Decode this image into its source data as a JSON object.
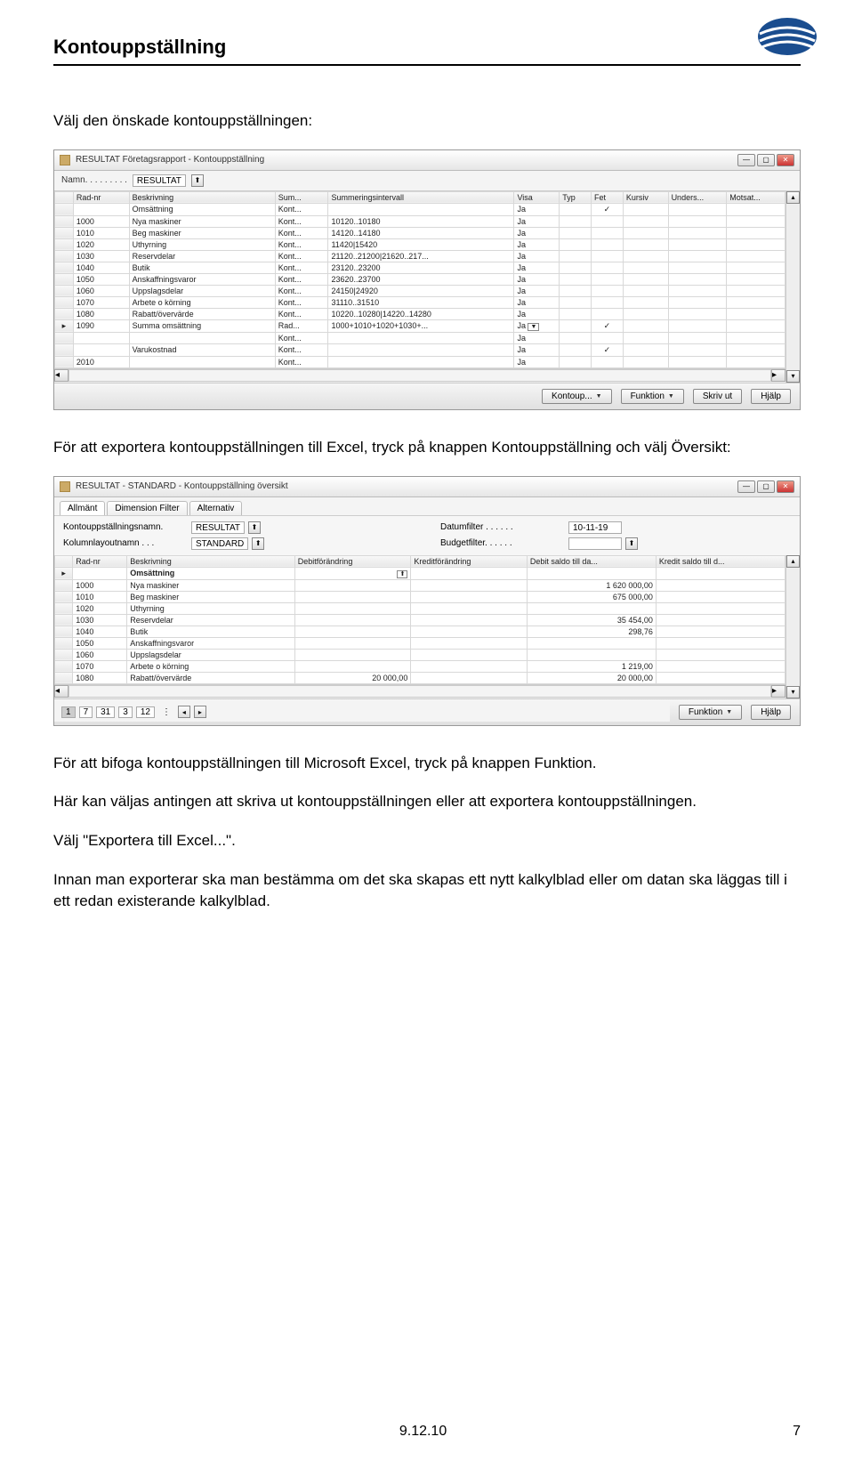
{
  "page_title": "Kontouppställning",
  "intro_text": "Välj den önskade kontouppställningen:",
  "para2": "För att exportera kontouppställningen till Excel, tryck på knappen Kontouppställning och välj Översikt:",
  "para3": "För att bifoga kontouppställningen till Microsoft Excel, tryck på knappen Funktion.",
  "para4": "Här kan väljas antingen att skriva ut kontouppställningen eller att exportera kontouppställningen.",
  "para5": "Välj \"Exportera till Excel...\".",
  "para6": "Innan man exporterar ska man bestämma om det ska skapas ett nytt kalkylblad eller om datan ska läggas till i ett redan existerande kalkylblad.",
  "footer_date": "9.12.10",
  "footer_page": "7",
  "win1": {
    "title": "RESULTAT Företagsrapport - Kontouppställning",
    "name_label": "Namn. . . . . . . . .",
    "name_value": "RESULTAT",
    "headers": [
      "Rad-nr",
      "Beskrivning",
      "Sum...",
      "Summeringsintervall",
      "Visa",
      "Typ",
      "Fet",
      "Kursiv",
      "Unders...",
      "Motsat..."
    ],
    "rows": [
      {
        "rad": "",
        "beskr": "Omsättning",
        "sum": "Kont...",
        "si": "",
        "visa": "Ja",
        "typ": "",
        "fet": "✓"
      },
      {
        "rad": "1000",
        "beskr": "Nya maskiner",
        "sum": "Kont...",
        "si": "10120..10180",
        "visa": "Ja"
      },
      {
        "rad": "1010",
        "beskr": "Beg maskiner",
        "sum": "Kont...",
        "si": "14120..14180",
        "visa": "Ja"
      },
      {
        "rad": "1020",
        "beskr": "Uthyrning",
        "sum": "Kont...",
        "si": "11420|15420",
        "visa": "Ja"
      },
      {
        "rad": "1030",
        "beskr": "Reservdelar",
        "sum": "Kont...",
        "si": "21120..21200|21620..217...",
        "visa": "Ja"
      },
      {
        "rad": "1040",
        "beskr": "Butik",
        "sum": "Kont...",
        "si": "23120..23200",
        "visa": "Ja"
      },
      {
        "rad": "1050",
        "beskr": "Anskaffningsvaror",
        "sum": "Kont...",
        "si": "23620..23700",
        "visa": "Ja"
      },
      {
        "rad": "1060",
        "beskr": "Uppslagsdelar",
        "sum": "Kont...",
        "si": "24150|24920",
        "visa": "Ja"
      },
      {
        "rad": "1070",
        "beskr": "Arbete o körning",
        "sum": "Kont...",
        "si": "31110..31510",
        "visa": "Ja"
      },
      {
        "rad": "1080",
        "beskr": "Rabatt/övervärde",
        "sum": "Kont...",
        "si": "10220..10280|14220..14280",
        "visa": "Ja"
      },
      {
        "rad": "1090",
        "beskr": "Summa omsättning",
        "sum": "Rad...",
        "si": "1000+1010+1020+1030+...",
        "visa": "Ja",
        "typ": "",
        "fet": "✓",
        "arrow": true
      },
      {
        "rad": "",
        "beskr": "",
        "sum": "Kont...",
        "si": "",
        "visa": "Ja"
      },
      {
        "rad": "",
        "beskr": "Varukostnad",
        "sum": "Kont...",
        "si": "",
        "visa": "Ja",
        "fet": "✓"
      },
      {
        "rad": "2010",
        "beskr": "",
        "sum": "Kont...",
        "si": "",
        "visa": "Ja"
      }
    ],
    "buttons": {
      "kontoup": "Kontoup...",
      "funktion": "Funktion",
      "skriv": "Skriv ut",
      "hjalp": "Hjälp"
    }
  },
  "win2": {
    "title": "RESULTAT - STANDARD - Kontouppställning översikt",
    "tabs": [
      "Allmänt",
      "Dimension Filter",
      "Alternativ"
    ],
    "form": {
      "knamn_label": "Kontouppställningsnamn.",
      "knamn_value": "RESULTAT",
      "kol_label": "Kolumnlayoutnamn . . .",
      "kol_value": "STANDARD",
      "datum_label": "Datumfilter . . . . . .",
      "datum_value": "10-11-19",
      "budget_label": "Budgetfilter. . . . . .",
      "budget_value": ""
    },
    "headers": [
      "Rad-nr",
      "Beskrivning",
      "Debitförändring",
      "Kreditförändring",
      "Debit saldo till da...",
      "Kredit saldo till d..."
    ],
    "rows": [
      {
        "rad": "",
        "beskr": "Omsättning",
        "bold": true
      },
      {
        "rad": "1000",
        "beskr": "Nya maskiner",
        "v5": "1 620 000,00"
      },
      {
        "rad": "1010",
        "beskr": "Beg maskiner",
        "v5": "675 000,00"
      },
      {
        "rad": "1020",
        "beskr": "Uthyrning"
      },
      {
        "rad": "1030",
        "beskr": "Reservdelar",
        "v5": "35 454,00"
      },
      {
        "rad": "1040",
        "beskr": "Butik",
        "v5": "298,76"
      },
      {
        "rad": "1050",
        "beskr": "Anskaffningsvaror"
      },
      {
        "rad": "1060",
        "beskr": "Uppslagsdelar"
      },
      {
        "rad": "1070",
        "beskr": "Arbete o körning",
        "v5": "1 219,00"
      },
      {
        "rad": "1080",
        "beskr": "Rabatt/övervärde",
        "v3": "20 000,00",
        "v5": "20 000,00"
      }
    ],
    "pager": [
      "1",
      "7",
      "31",
      "3",
      "12"
    ],
    "buttons": {
      "funktion": "Funktion",
      "hjalp": "Hjälp"
    }
  }
}
